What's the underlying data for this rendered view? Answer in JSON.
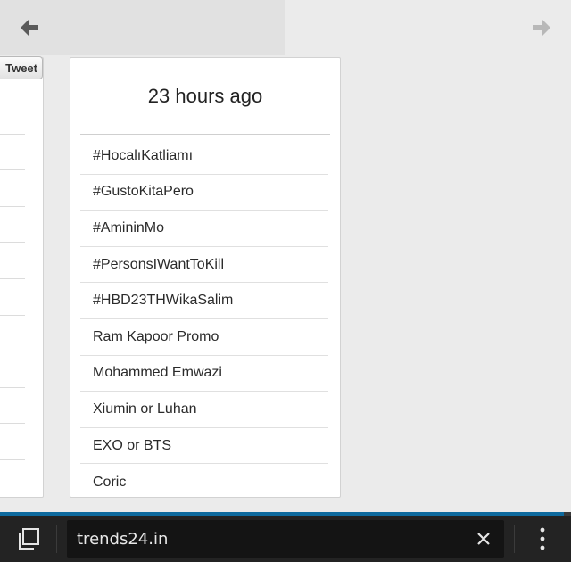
{
  "navigation": {
    "back_icon": "arrow-left-icon",
    "forward_icon": "arrow-right-icon",
    "back_color": "#5a5a5a",
    "forward_color": "#b8b8b8"
  },
  "left_card": {
    "tweet_label": "Tweet"
  },
  "main_card": {
    "title": "23 hours ago",
    "trends": [
      "#HocalıKatliamı",
      "#GustoKitaPero",
      "#AmininMo",
      "#PersonsIWantToKill",
      "#HBD23THWikaSalim",
      "Ram Kapoor Promo",
      "Mohammed Emwazi",
      "Xiumin or Luhan",
      "EXO or BTS",
      "Coric"
    ]
  },
  "browser_bar": {
    "url": "trends24.in",
    "tabs_icon": "tabs-icon",
    "clear_icon": "close-icon",
    "menu_icon": "more-vertical-icon",
    "accent_color": "#0e6a9e"
  }
}
